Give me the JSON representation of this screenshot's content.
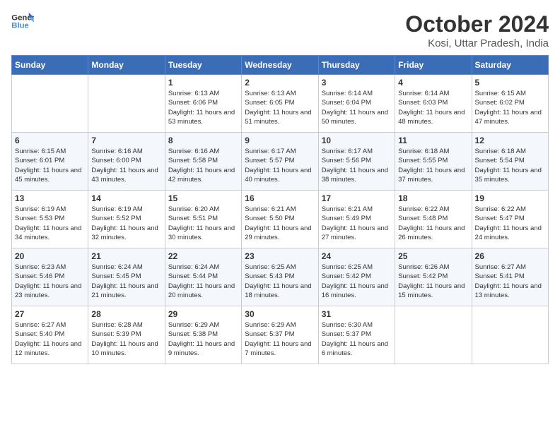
{
  "header": {
    "logo_line1": "General",
    "logo_line2": "Blue",
    "month": "October 2024",
    "location": "Kosi, Uttar Pradesh, India"
  },
  "weekdays": [
    "Sunday",
    "Monday",
    "Tuesday",
    "Wednesday",
    "Thursday",
    "Friday",
    "Saturday"
  ],
  "weeks": [
    [
      {
        "day": "",
        "sunrise": "",
        "sunset": "",
        "daylight": ""
      },
      {
        "day": "",
        "sunrise": "",
        "sunset": "",
        "daylight": ""
      },
      {
        "day": "1",
        "sunrise": "Sunrise: 6:13 AM",
        "sunset": "Sunset: 6:06 PM",
        "daylight": "Daylight: 11 hours and 53 minutes."
      },
      {
        "day": "2",
        "sunrise": "Sunrise: 6:13 AM",
        "sunset": "Sunset: 6:05 PM",
        "daylight": "Daylight: 11 hours and 51 minutes."
      },
      {
        "day": "3",
        "sunrise": "Sunrise: 6:14 AM",
        "sunset": "Sunset: 6:04 PM",
        "daylight": "Daylight: 11 hours and 50 minutes."
      },
      {
        "day": "4",
        "sunrise": "Sunrise: 6:14 AM",
        "sunset": "Sunset: 6:03 PM",
        "daylight": "Daylight: 11 hours and 48 minutes."
      },
      {
        "day": "5",
        "sunrise": "Sunrise: 6:15 AM",
        "sunset": "Sunset: 6:02 PM",
        "daylight": "Daylight: 11 hours and 47 minutes."
      }
    ],
    [
      {
        "day": "6",
        "sunrise": "Sunrise: 6:15 AM",
        "sunset": "Sunset: 6:01 PM",
        "daylight": "Daylight: 11 hours and 45 minutes."
      },
      {
        "day": "7",
        "sunrise": "Sunrise: 6:16 AM",
        "sunset": "Sunset: 6:00 PM",
        "daylight": "Daylight: 11 hours and 43 minutes."
      },
      {
        "day": "8",
        "sunrise": "Sunrise: 6:16 AM",
        "sunset": "Sunset: 5:58 PM",
        "daylight": "Daylight: 11 hours and 42 minutes."
      },
      {
        "day": "9",
        "sunrise": "Sunrise: 6:17 AM",
        "sunset": "Sunset: 5:57 PM",
        "daylight": "Daylight: 11 hours and 40 minutes."
      },
      {
        "day": "10",
        "sunrise": "Sunrise: 6:17 AM",
        "sunset": "Sunset: 5:56 PM",
        "daylight": "Daylight: 11 hours and 38 minutes."
      },
      {
        "day": "11",
        "sunrise": "Sunrise: 6:18 AM",
        "sunset": "Sunset: 5:55 PM",
        "daylight": "Daylight: 11 hours and 37 minutes."
      },
      {
        "day": "12",
        "sunrise": "Sunrise: 6:18 AM",
        "sunset": "Sunset: 5:54 PM",
        "daylight": "Daylight: 11 hours and 35 minutes."
      }
    ],
    [
      {
        "day": "13",
        "sunrise": "Sunrise: 6:19 AM",
        "sunset": "Sunset: 5:53 PM",
        "daylight": "Daylight: 11 hours and 34 minutes."
      },
      {
        "day": "14",
        "sunrise": "Sunrise: 6:19 AM",
        "sunset": "Sunset: 5:52 PM",
        "daylight": "Daylight: 11 hours and 32 minutes."
      },
      {
        "day": "15",
        "sunrise": "Sunrise: 6:20 AM",
        "sunset": "Sunset: 5:51 PM",
        "daylight": "Daylight: 11 hours and 30 minutes."
      },
      {
        "day": "16",
        "sunrise": "Sunrise: 6:21 AM",
        "sunset": "Sunset: 5:50 PM",
        "daylight": "Daylight: 11 hours and 29 minutes."
      },
      {
        "day": "17",
        "sunrise": "Sunrise: 6:21 AM",
        "sunset": "Sunset: 5:49 PM",
        "daylight": "Daylight: 11 hours and 27 minutes."
      },
      {
        "day": "18",
        "sunrise": "Sunrise: 6:22 AM",
        "sunset": "Sunset: 5:48 PM",
        "daylight": "Daylight: 11 hours and 26 minutes."
      },
      {
        "day": "19",
        "sunrise": "Sunrise: 6:22 AM",
        "sunset": "Sunset: 5:47 PM",
        "daylight": "Daylight: 11 hours and 24 minutes."
      }
    ],
    [
      {
        "day": "20",
        "sunrise": "Sunrise: 6:23 AM",
        "sunset": "Sunset: 5:46 PM",
        "daylight": "Daylight: 11 hours and 23 minutes."
      },
      {
        "day": "21",
        "sunrise": "Sunrise: 6:24 AM",
        "sunset": "Sunset: 5:45 PM",
        "daylight": "Daylight: 11 hours and 21 minutes."
      },
      {
        "day": "22",
        "sunrise": "Sunrise: 6:24 AM",
        "sunset": "Sunset: 5:44 PM",
        "daylight": "Daylight: 11 hours and 20 minutes."
      },
      {
        "day": "23",
        "sunrise": "Sunrise: 6:25 AM",
        "sunset": "Sunset: 5:43 PM",
        "daylight": "Daylight: 11 hours and 18 minutes."
      },
      {
        "day": "24",
        "sunrise": "Sunrise: 6:25 AM",
        "sunset": "Sunset: 5:42 PM",
        "daylight": "Daylight: 11 hours and 16 minutes."
      },
      {
        "day": "25",
        "sunrise": "Sunrise: 6:26 AM",
        "sunset": "Sunset: 5:42 PM",
        "daylight": "Daylight: 11 hours and 15 minutes."
      },
      {
        "day": "26",
        "sunrise": "Sunrise: 6:27 AM",
        "sunset": "Sunset: 5:41 PM",
        "daylight": "Daylight: 11 hours and 13 minutes."
      }
    ],
    [
      {
        "day": "27",
        "sunrise": "Sunrise: 6:27 AM",
        "sunset": "Sunset: 5:40 PM",
        "daylight": "Daylight: 11 hours and 12 minutes."
      },
      {
        "day": "28",
        "sunrise": "Sunrise: 6:28 AM",
        "sunset": "Sunset: 5:39 PM",
        "daylight": "Daylight: 11 hours and 10 minutes."
      },
      {
        "day": "29",
        "sunrise": "Sunrise: 6:29 AM",
        "sunset": "Sunset: 5:38 PM",
        "daylight": "Daylight: 11 hours and 9 minutes."
      },
      {
        "day": "30",
        "sunrise": "Sunrise: 6:29 AM",
        "sunset": "Sunset: 5:37 PM",
        "daylight": "Daylight: 11 hours and 7 minutes."
      },
      {
        "day": "31",
        "sunrise": "Sunrise: 6:30 AM",
        "sunset": "Sunset: 5:37 PM",
        "daylight": "Daylight: 11 hours and 6 minutes."
      },
      {
        "day": "",
        "sunrise": "",
        "sunset": "",
        "daylight": ""
      },
      {
        "day": "",
        "sunrise": "",
        "sunset": "",
        "daylight": ""
      }
    ]
  ]
}
